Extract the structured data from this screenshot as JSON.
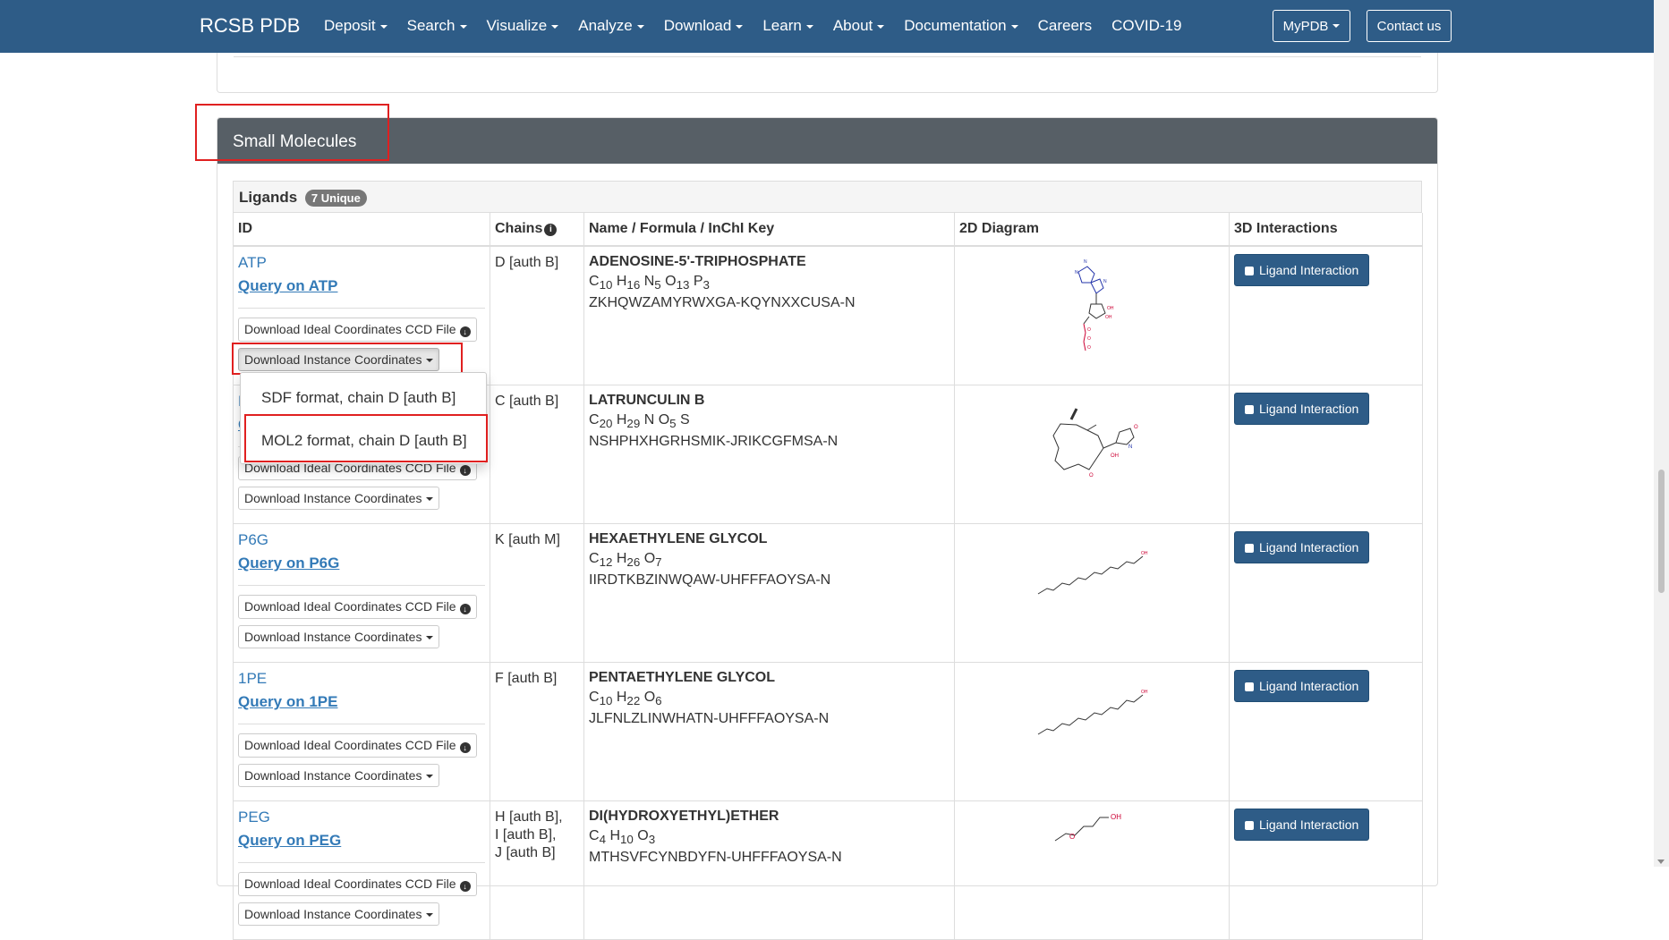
{
  "navbar": {
    "brand": "RCSB PDB",
    "items": [
      {
        "label": "Deposit",
        "dropdown": true
      },
      {
        "label": "Search",
        "dropdown": true
      },
      {
        "label": "Visualize",
        "dropdown": true
      },
      {
        "label": "Analyze",
        "dropdown": true
      },
      {
        "label": "Download",
        "dropdown": true
      },
      {
        "label": "Learn",
        "dropdown": true
      },
      {
        "label": "About",
        "dropdown": true
      },
      {
        "label": "Documentation",
        "dropdown": true
      },
      {
        "label": "Careers",
        "dropdown": false
      },
      {
        "label": "COVID-19",
        "dropdown": false
      }
    ],
    "mypdb_label": "MyPDB",
    "contact_label": "Contact us"
  },
  "panel": {
    "title": "Small Molecules",
    "ligands_label": "Ligands",
    "unique_badge": "7 Unique"
  },
  "table": {
    "headers": {
      "id": "ID",
      "chains": "Chains",
      "name": "Name / Formula / InChI Key",
      "diagram": "2D Diagram",
      "interactions": "3D Interactions"
    },
    "download_ideal_label": "Download Ideal Coordinates CCD File",
    "download_instance_label": "Download Instance Coordinates",
    "ligand_interaction_label": "Ligand Interaction",
    "rows": [
      {
        "id": "ATP",
        "query": "Query on ATP",
        "chains": "D [auth B]",
        "name": "ADENOSINE-5'-TRIPHOSPHATE",
        "formula": [
          [
            "C",
            "10"
          ],
          [
            "H",
            "16"
          ],
          [
            "N",
            "5"
          ],
          [
            "O",
            "13"
          ],
          [
            "P",
            "3"
          ]
        ],
        "inchi": "ZKHQWZAMYRWXGA-KQYNXXCUSA-N"
      },
      {
        "id": "LAB",
        "query": "Query on LAB",
        "chains": "C [auth B]",
        "name": "LATRUNCULIN B",
        "formula": [
          [
            "C",
            "20"
          ],
          [
            "H",
            "29"
          ],
          [
            "N",
            ""
          ],
          [
            "O",
            "5"
          ],
          [
            "S",
            ""
          ]
        ],
        "inchi": "NSHPHXHGRHSMIK-JRIKCGFMSA-N"
      },
      {
        "id": "P6G",
        "query": "Query on P6G",
        "chains": "K [auth M]",
        "name": "HEXAETHYLENE GLYCOL",
        "formula": [
          [
            "C",
            "12"
          ],
          [
            "H",
            "26"
          ],
          [
            "O",
            "7"
          ]
        ],
        "inchi": "IIRDTKBZINWQAW-UHFFFAOYSA-N"
      },
      {
        "id": "1PE",
        "query": "Query on 1PE",
        "chains": "F [auth B]",
        "name": "PENTAETHYLENE GLYCOL",
        "formula": [
          [
            "C",
            "10"
          ],
          [
            "H",
            "22"
          ],
          [
            "O",
            "6"
          ]
        ],
        "inchi": "JLFNLZLINWHATN-UHFFFAOYSA-N"
      },
      {
        "id": "PEG",
        "query": "Query on PEG",
        "chains": "H [auth B],\nI [auth B],\nJ [auth B]",
        "name": "DI(HYDROXYETHYL)ETHER",
        "formula": [
          [
            "C",
            "4"
          ],
          [
            "H",
            "10"
          ],
          [
            "O",
            "3"
          ]
        ],
        "inchi": "MTHSVFCYNBDYFN-UHFFFAOYSA-N"
      }
    ]
  },
  "dropdown": {
    "items": [
      "SDF format, chain D [auth B]",
      "MOL2 format, chain D [auth B]"
    ]
  },
  "colors": {
    "navbar": "#2e5c87",
    "panel_header": "#575f66",
    "link": "#337ab7",
    "highlight": "#e02020"
  }
}
